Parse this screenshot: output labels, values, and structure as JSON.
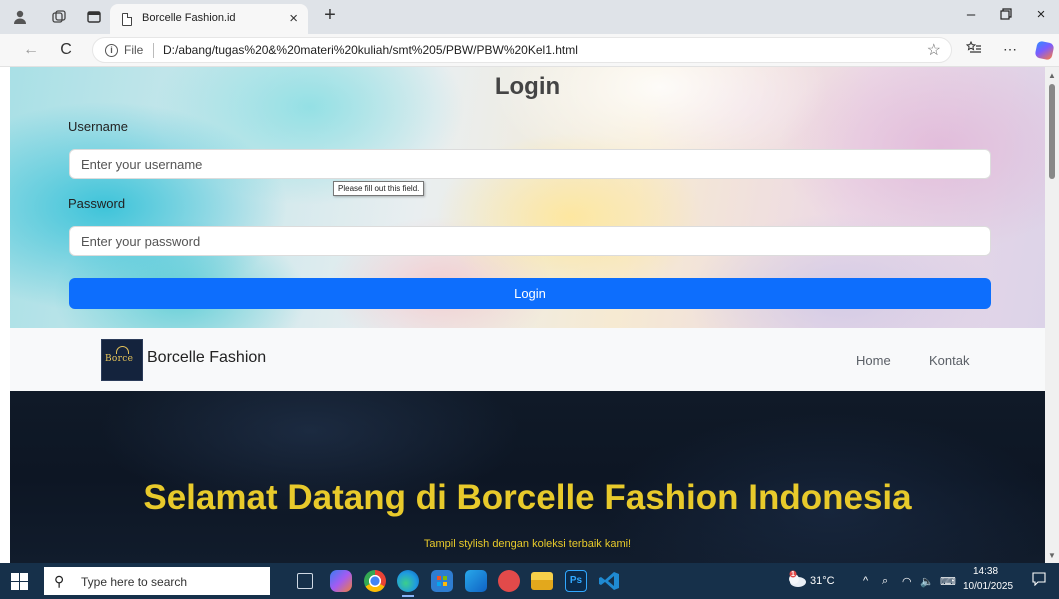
{
  "browser": {
    "tab": {
      "title": "Borcelle Fashion.id",
      "close": "×"
    },
    "new_tab": "+",
    "window_controls": {
      "minimize": "–",
      "restore": "ᗝ",
      "close": "×"
    },
    "address": {
      "scheme_label": "File",
      "url": "D:/abang/tugas%20&%20materi%20kuliah/smt%205/PBW/PBW%20Kel1.html"
    },
    "more": "⋯"
  },
  "login": {
    "title": "Login",
    "username": {
      "label": "Username",
      "placeholder": "Enter your username",
      "value": ""
    },
    "password": {
      "label": "Password",
      "placeholder": "Enter your password",
      "value": ""
    },
    "validation_tooltip": "Please fill out this field.",
    "submit_label": "Login"
  },
  "navbar": {
    "logo_text": "Borce",
    "brand": "Borcelle Fashion",
    "links": [
      "Home",
      "Kontak"
    ]
  },
  "hero": {
    "title": "Selamat Datang di Borcelle Fashion Indonesia",
    "subtitle": "Tampil stylish dengan koleksi terbaik kami!"
  },
  "taskbar": {
    "search_placeholder": "Type here to search",
    "weather": {
      "temp": "31°C",
      "badge": "1"
    },
    "clock": {
      "time": "14:38",
      "date": "10/01/2025"
    },
    "apps": [
      {
        "name": "task-view",
        "color": "#16304a"
      },
      {
        "name": "copilot",
        "color": "#5a8dee"
      },
      {
        "name": "chrome",
        "color": "#f2b311"
      },
      {
        "name": "edge",
        "color": "#1f9be0"
      },
      {
        "name": "store",
        "color": "#2e7dd1"
      },
      {
        "name": "outlook",
        "color": "#1a73c8"
      },
      {
        "name": "red-app",
        "color": "#e24a4a"
      },
      {
        "name": "file-explorer",
        "color": "#f1c232"
      },
      {
        "name": "photoshop",
        "color": "#0b2a4a"
      },
      {
        "name": "vscode",
        "color": "#1f8ad2"
      }
    ]
  },
  "colors": {
    "primary_button": "#0d6efd",
    "hero_text": "#e8ca2b",
    "navbar_bg": "#f8f9fa",
    "taskbar_bg": "#16304a"
  }
}
